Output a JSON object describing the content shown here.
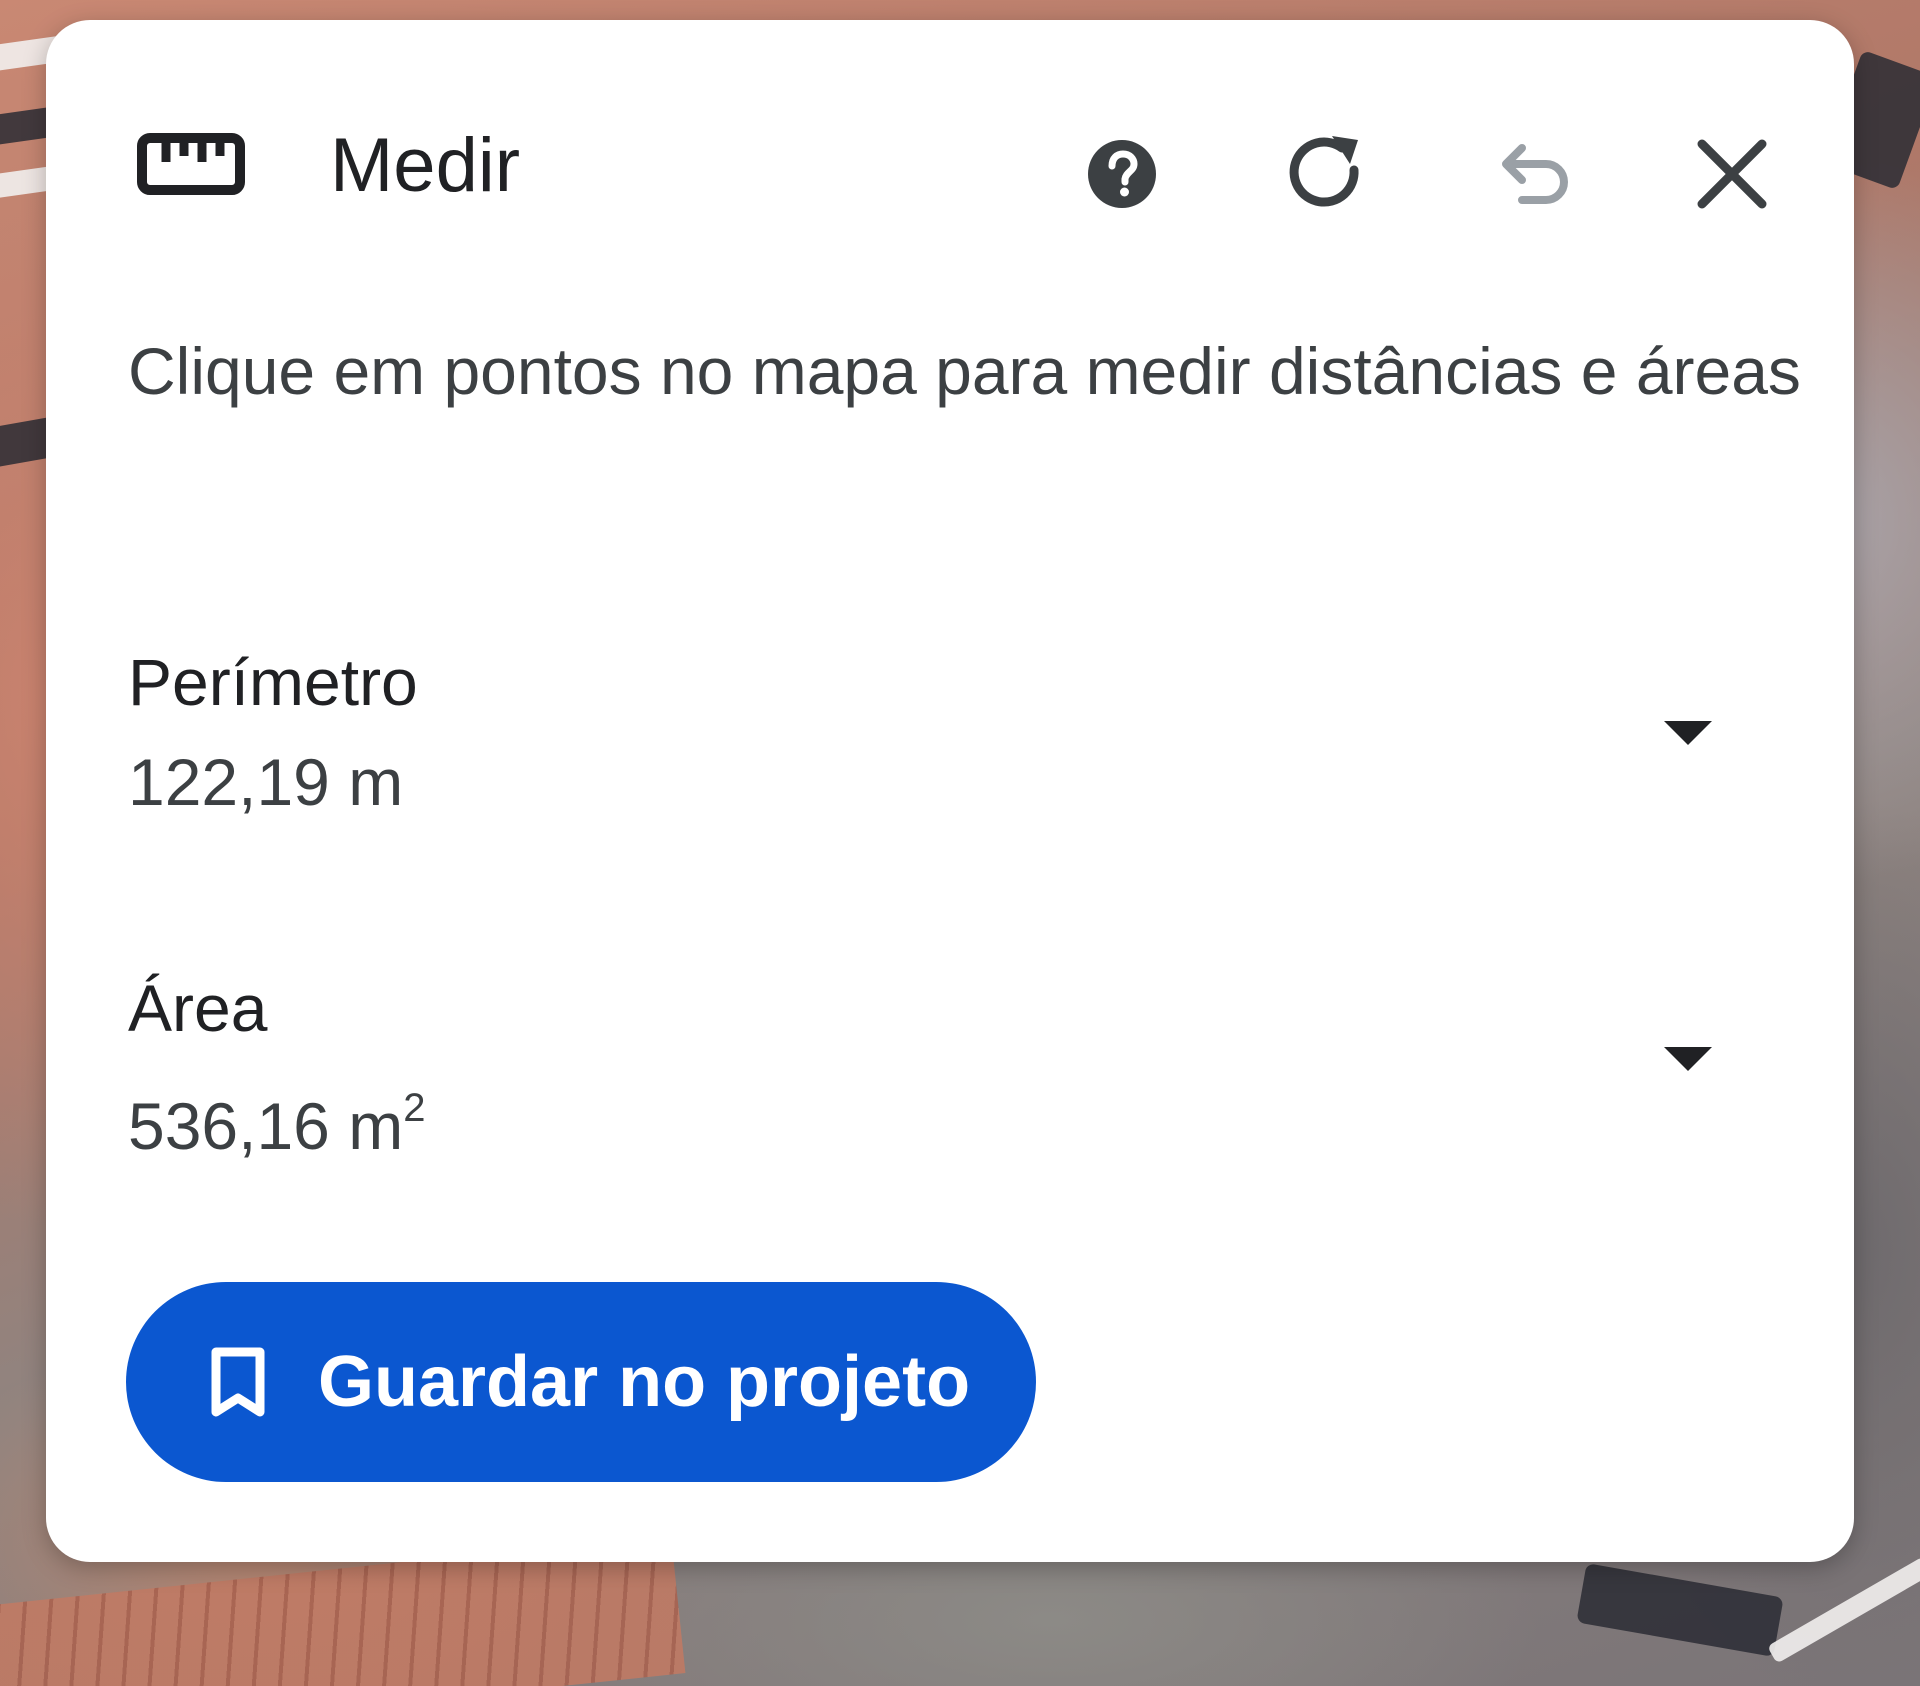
{
  "map": {
    "description_hidden": ""
  },
  "panel": {
    "title": "Medir",
    "hint": "Clique em pontos no mapa para medir distâncias e áreas",
    "actions": {
      "help_icon": "help-circle-icon",
      "redo_icon": "redo-icon",
      "undo_icon": "undo-icon",
      "close_icon": "close-icon"
    },
    "measurements": [
      {
        "label": "Perímetro",
        "value": "122,19 m"
      },
      {
        "label": "Área",
        "value": "536,16 m",
        "superscript": "2"
      }
    ],
    "save_button": {
      "label": "Guardar no projeto",
      "icon": "bookmark-icon"
    }
  },
  "colors": {
    "accent": "#0b57d0",
    "text_primary": "#202124",
    "text_secondary": "#3c4043",
    "icon_disabled": "#9aa0a6"
  }
}
